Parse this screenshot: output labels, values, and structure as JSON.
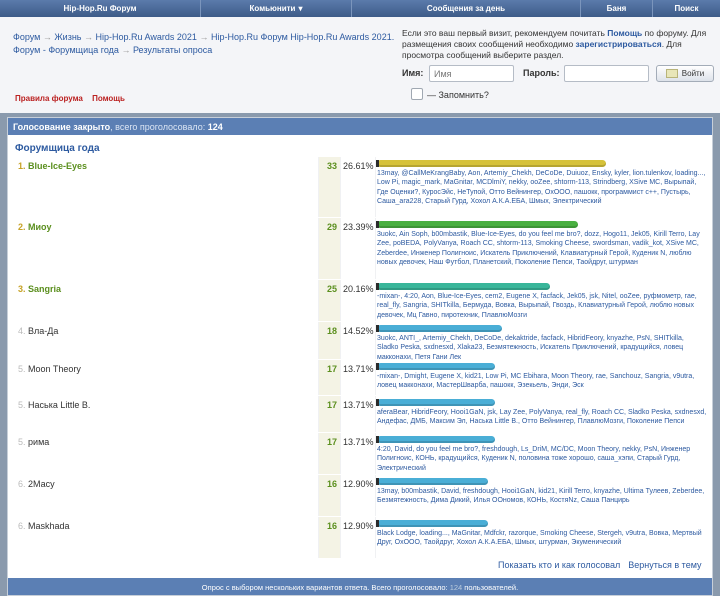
{
  "nav": {
    "items": [
      "Hip-Hop.Ru Форум",
      "Комьюнити",
      "Сообщения за день",
      "Баня",
      "Поиск"
    ]
  },
  "breadcrumb": {
    "items": [
      "Форум",
      "Жизнь",
      "Hip-Hop.Ru Awards 2021",
      "Hip-Hop.Ru Форум Hip-Hop.Ru Awards 2021. Форум - Форумщица года",
      "Результаты опроса"
    ],
    "separator": "→"
  },
  "header_links": {
    "rules": "Правила форума",
    "help": "Помощь"
  },
  "login": {
    "note_1": "Если это ваш первый визит, рекомендуем почитать",
    "help_link": "Помощь",
    "note_2": "по форуму. Для размещения своих сообщений необходимо",
    "register_link": "зарегистрироваться",
    "note_3": ". Для просмотра сообщений выберите раздел.",
    "name_label": "Имя:",
    "name_placeholder": "Имя",
    "password_label": "Пароль:",
    "button": "Войти",
    "remember": "— Запомнить?"
  },
  "poll": {
    "status": "Голосование закрыто",
    "voted_label": ", всего проголосовало:",
    "voted_total": "124",
    "question": "Форумщица года",
    "show_voters": "Показать кто и как голосовал",
    "back": "Вернуться в тему",
    "footer_1": "Опрос с выбором нескольких вариантов ответа. Всего проголосовало:",
    "footer_total": "124",
    "footer_2": "пользователей.",
    "options": [
      {
        "num": "1.",
        "name": "Blue-Ice-Eyes",
        "votes": "33",
        "percent": "26.61%",
        "share": 0.2661,
        "bar_color": "#d6c23a",
        "voters": "13may, @CallMeKrangBaby, Aon, Artemiy_Chekh, DeCoDe, Duiuoz, Ensky, kyler, lion.tulenkov, loading..., Low Pi, magic_mark, MaGnitar, MCDlmiY, nekky, ooZee, shtorm-113, Strindberg, XSive MC, Вырыпай, Где Оценки?, КуросЭйс, НеТупой, Отто Вейнингер, OxOOO, пашокк, программист с++, Пустырь, Саша_ага228, Старый Гурд, Хохол А.К.А.ЕБА, Шмых, Электрический"
      },
      {
        "num": "2.",
        "name": "Миоу",
        "votes": "29",
        "percent": "23.39%",
        "share": 0.2339,
        "bar_color": "#49b040",
        "voters": "3uokc, Ain Soph, b00mbastik, Blue-Ice-Eyes, do you feel me bro?, dozz, Hogo11, Jek05, Kirill Terro, Lay Zee, poBEDA, PolyVanya, Roach CC, shtorm-113, Smoking Cheese, swordsman, vadik_kot, XSive MC, Zeberdee, Инженер Полигноис, Искатель Приключений, Клавиатурный Герой, Куденик N, люблю новых девочек, Наш Футбол, Планетский, Поколение Пепси, Таойдруг, штурман"
      },
      {
        "num": "3.",
        "name": "Sangria",
        "votes": "25",
        "percent": "20.16%",
        "share": 0.2016,
        "bar_color": "#39b69a",
        "voters": "-mixan-, 4:20, Aon, Blue-Ice-Eyes, cem2, Eugene X, facfack, Jek05, jsk, Nitel, ooZee, руфмометр, rae, real_fly, Sangria, SHITkilla, Бермуда, Вовка, Вырыпай, Гвоздь, Клавиатурный Герой, люблю новых девочек, Мц Гавно, пиротехник, ПлавлюМозги"
      },
      {
        "num": "4.",
        "name": "Вла-Да",
        "votes": "18",
        "percent": "14.52%",
        "share": 0.1452,
        "bar_color": "#4aaed6",
        "voters": "3uokc, ANTI_, Artemiy_Chekh, DeCoDe, dekaktride, facfack, HibridFeory, knyazhe, PsN, SHITkilla, Sladko Peska, sxdnesxd, Xlaka23, Безмятежность, Искатель Приключений, крадущийся, ловец макконахи, Петя Гани Лек"
      },
      {
        "num": "5.",
        "name": "Moon Theory",
        "votes": "17",
        "percent": "13.71%",
        "share": 0.1371,
        "bar_color": "#4aaed6",
        "voters": "-mixan-, Dmight, Eugene X, kid21, Low Pi, MC Ebihara, Moon Theory, rae, Sanchouz, Sangria, v9utra, ловец макконахи, МастерШварба, пашокк, Эзекьель, Энди, Эск"
      },
      {
        "num": "5.",
        "name": "Наська Little B.",
        "votes": "17",
        "percent": "13.71%",
        "share": 0.1371,
        "bar_color": "#4aaed6",
        "voters": "aferaBear, HibridFeory, Hooi1GaN, jsk, Lay Zee, PolyVanya, real_fly, Roach CC, Sladko Peska, sxdnesxd, Андефас, ДМБ, Максим Эл, Наська Little B., Отто Вейнингер, ПлавлюМозги, Поколение Пепси"
      },
      {
        "num": "5.",
        "name": "рима",
        "votes": "17",
        "percent": "13.71%",
        "share": 0.1371,
        "bar_color": "#4aaed6",
        "voters": "4:20, David, do you feel me bro?, freshdough, Ls_DriM, MC/DC, Moon Theory, nekky, PsN, Инженер Полигноис, КОНЬ, крадущийся, Куденик N, половина тоже хорошо, саша_хэпи, Старый Гурд, Электрический"
      },
      {
        "num": "6.",
        "name": "2Масу",
        "votes": "16",
        "percent": "12.90%",
        "share": 0.129,
        "bar_color": "#4aaed6",
        "voters": "13may, b00mbastik, David, freshdough, Hooi1GaN, kid21, Kirill Terro, knyazhe, Ultima Тулеев, Zeberdee, Безмятежность, Дима Дикий, Илья ООномов, КОНЬ, КостяNz, Саша Панцирь"
      },
      {
        "num": "6.",
        "name": "Maskhada",
        "votes": "16",
        "percent": "12.90%",
        "share": 0.129,
        "bar_color": "#4aaed6",
        "voters": "Black Lodge, loading..., MaGnitar, Mdfckr, razorque, Smoking Cheese, Stergeh, v9utra, Вовка, Мертвый Друг, OxOOO, Таойдруг, Хохол А.К.А.ЕБА, Шмых, штурман, Экуменический"
      }
    ]
  }
}
